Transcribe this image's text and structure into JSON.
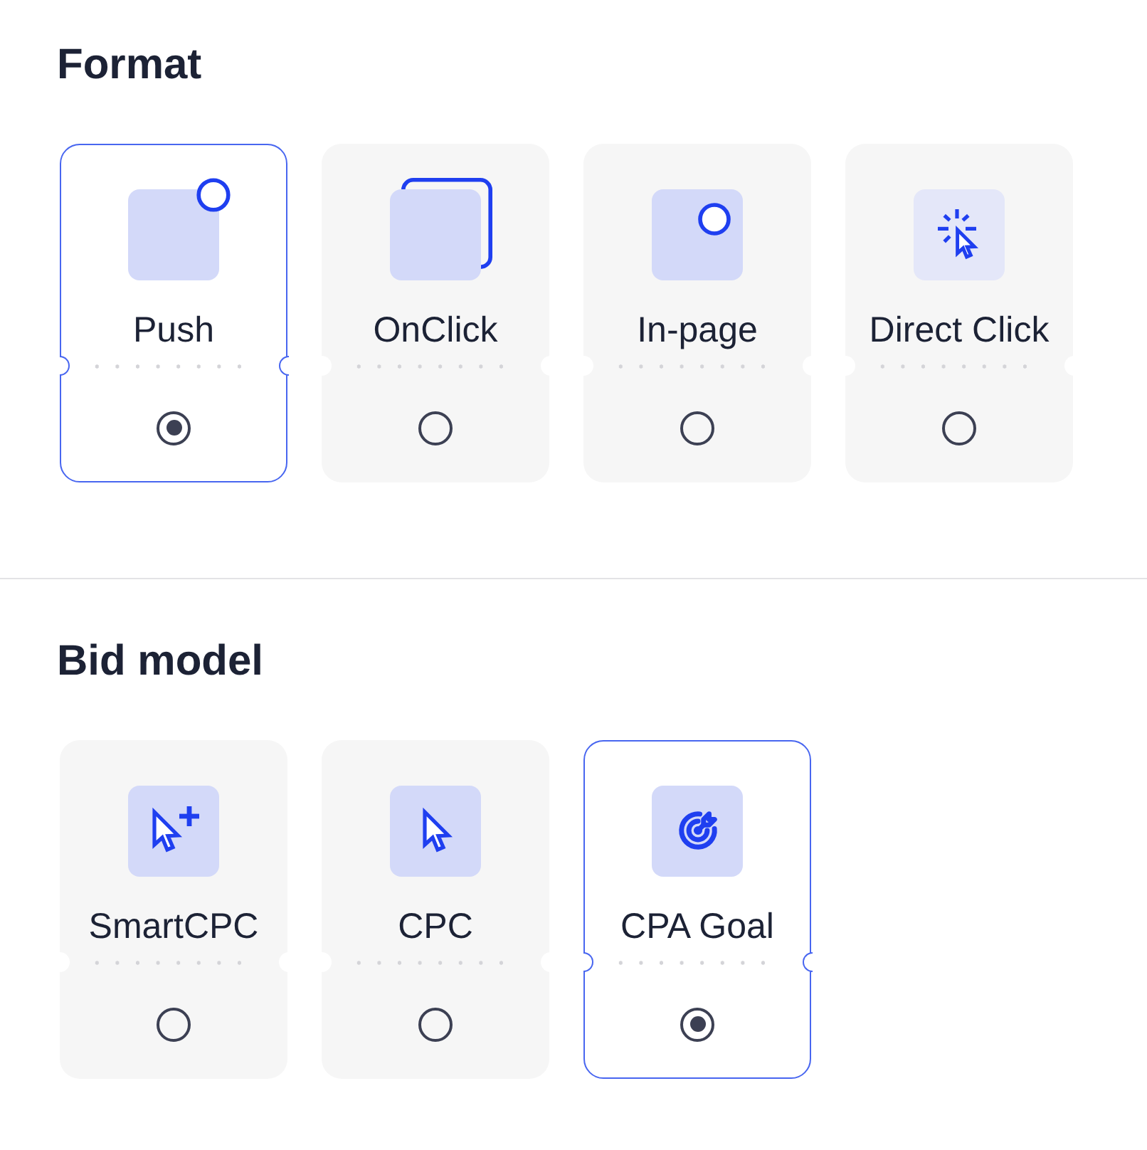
{
  "sections": [
    {
      "title": "Format",
      "options": [
        {
          "label": "Push",
          "kind": "push",
          "selected": true
        },
        {
          "label": "OnClick",
          "kind": "onclick",
          "selected": false
        },
        {
          "label": "In-page",
          "kind": "inpage",
          "selected": false
        },
        {
          "label": "Direct Click",
          "kind": "directclick",
          "selected": false
        }
      ]
    },
    {
      "title": "Bid model",
      "options": [
        {
          "label": "SmartCPC",
          "kind": "smartcpc",
          "selected": false
        },
        {
          "label": "CPC",
          "kind": "cpc",
          "selected": false
        },
        {
          "label": "CPA Goal",
          "kind": "cpagoal",
          "selected": true
        }
      ]
    }
  ]
}
